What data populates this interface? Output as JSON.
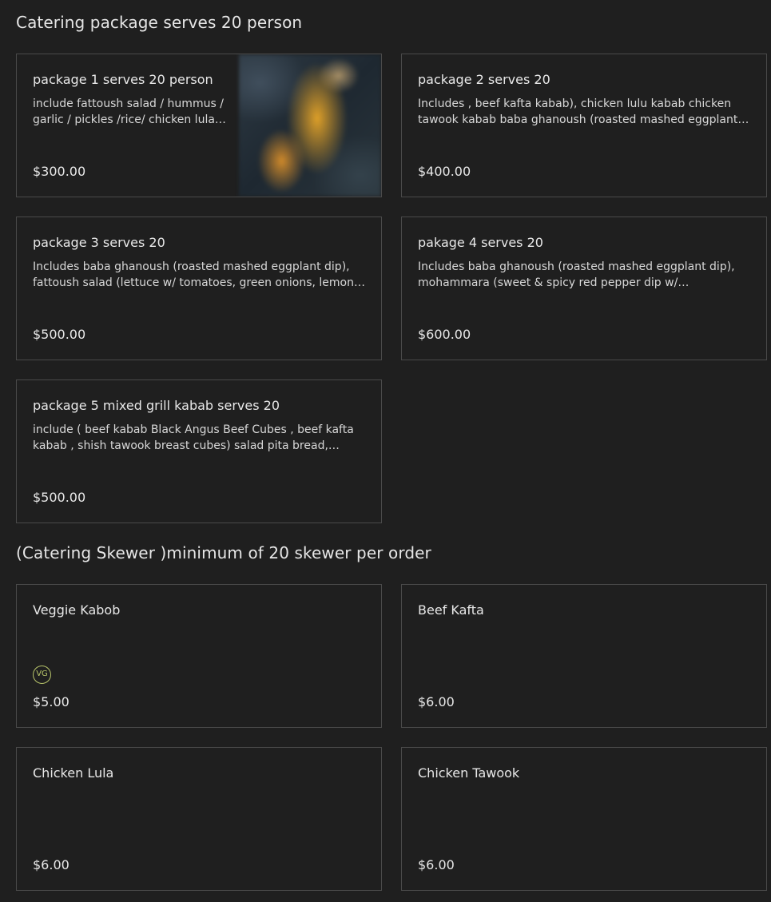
{
  "sections": [
    {
      "title": "Catering package serves 20 person",
      "items": [
        {
          "name": "package 1 serves 20 person",
          "description": "include fattoush salad / hummus / garlic / pickles /rice/ chicken lula kabab / beef kafta kabab / shish tawook",
          "price": "$300.00",
          "has_image": true
        },
        {
          "name": "package 2 serves 20",
          "description": "Includes , beef kafta kabab), chicken lulu kabab chicken tawook kabab baba ghanoush (roasted mashed eggplant dip) fattoush salad",
          "price": "$400.00"
        },
        {
          "name": "package 3 serves 20",
          "description": "Includes baba ghanoush (roasted mashed eggplant dip), fattoush salad (lettuce w/ tomatoes, green onions, lemon juice)",
          "price": "$500.00"
        },
        {
          "name": "pakage 4 serves 20",
          "description": "Includes baba ghanoush (roasted mashed eggplant dip), mohammara (sweet & spicy red pepper dip w/ pomegranate molasses)",
          "price": "$600.00"
        },
        {
          "name": "package 5 mixed grill kabab serves 20",
          "description": "include ( beef kabab Black Angus Beef Cubes , beef kafta kabab , shish tawook breast cubes) salad pita bread, garlic, pickles",
          "price": "$500.00"
        }
      ]
    },
    {
      "title": "(Catering Skewer )minimum of 20 skewer per order",
      "items": [
        {
          "name": "Veggie Kabob",
          "price": "$5.00",
          "badge": "VG"
        },
        {
          "name": "Beef Kafta",
          "price": "$6.00"
        },
        {
          "name": "Chicken Lula",
          "price": "$6.00"
        },
        {
          "name": "Chicken Tawook",
          "price": "$6.00"
        }
      ]
    }
  ],
  "colors": {
    "background": "#1f1f1f",
    "card_border": "#4a4a4a",
    "text": "#e8e8e8",
    "vegan_badge": "#b7c46a"
  },
  "icons": {
    "vegan_badge": "vg-badge-icon"
  }
}
